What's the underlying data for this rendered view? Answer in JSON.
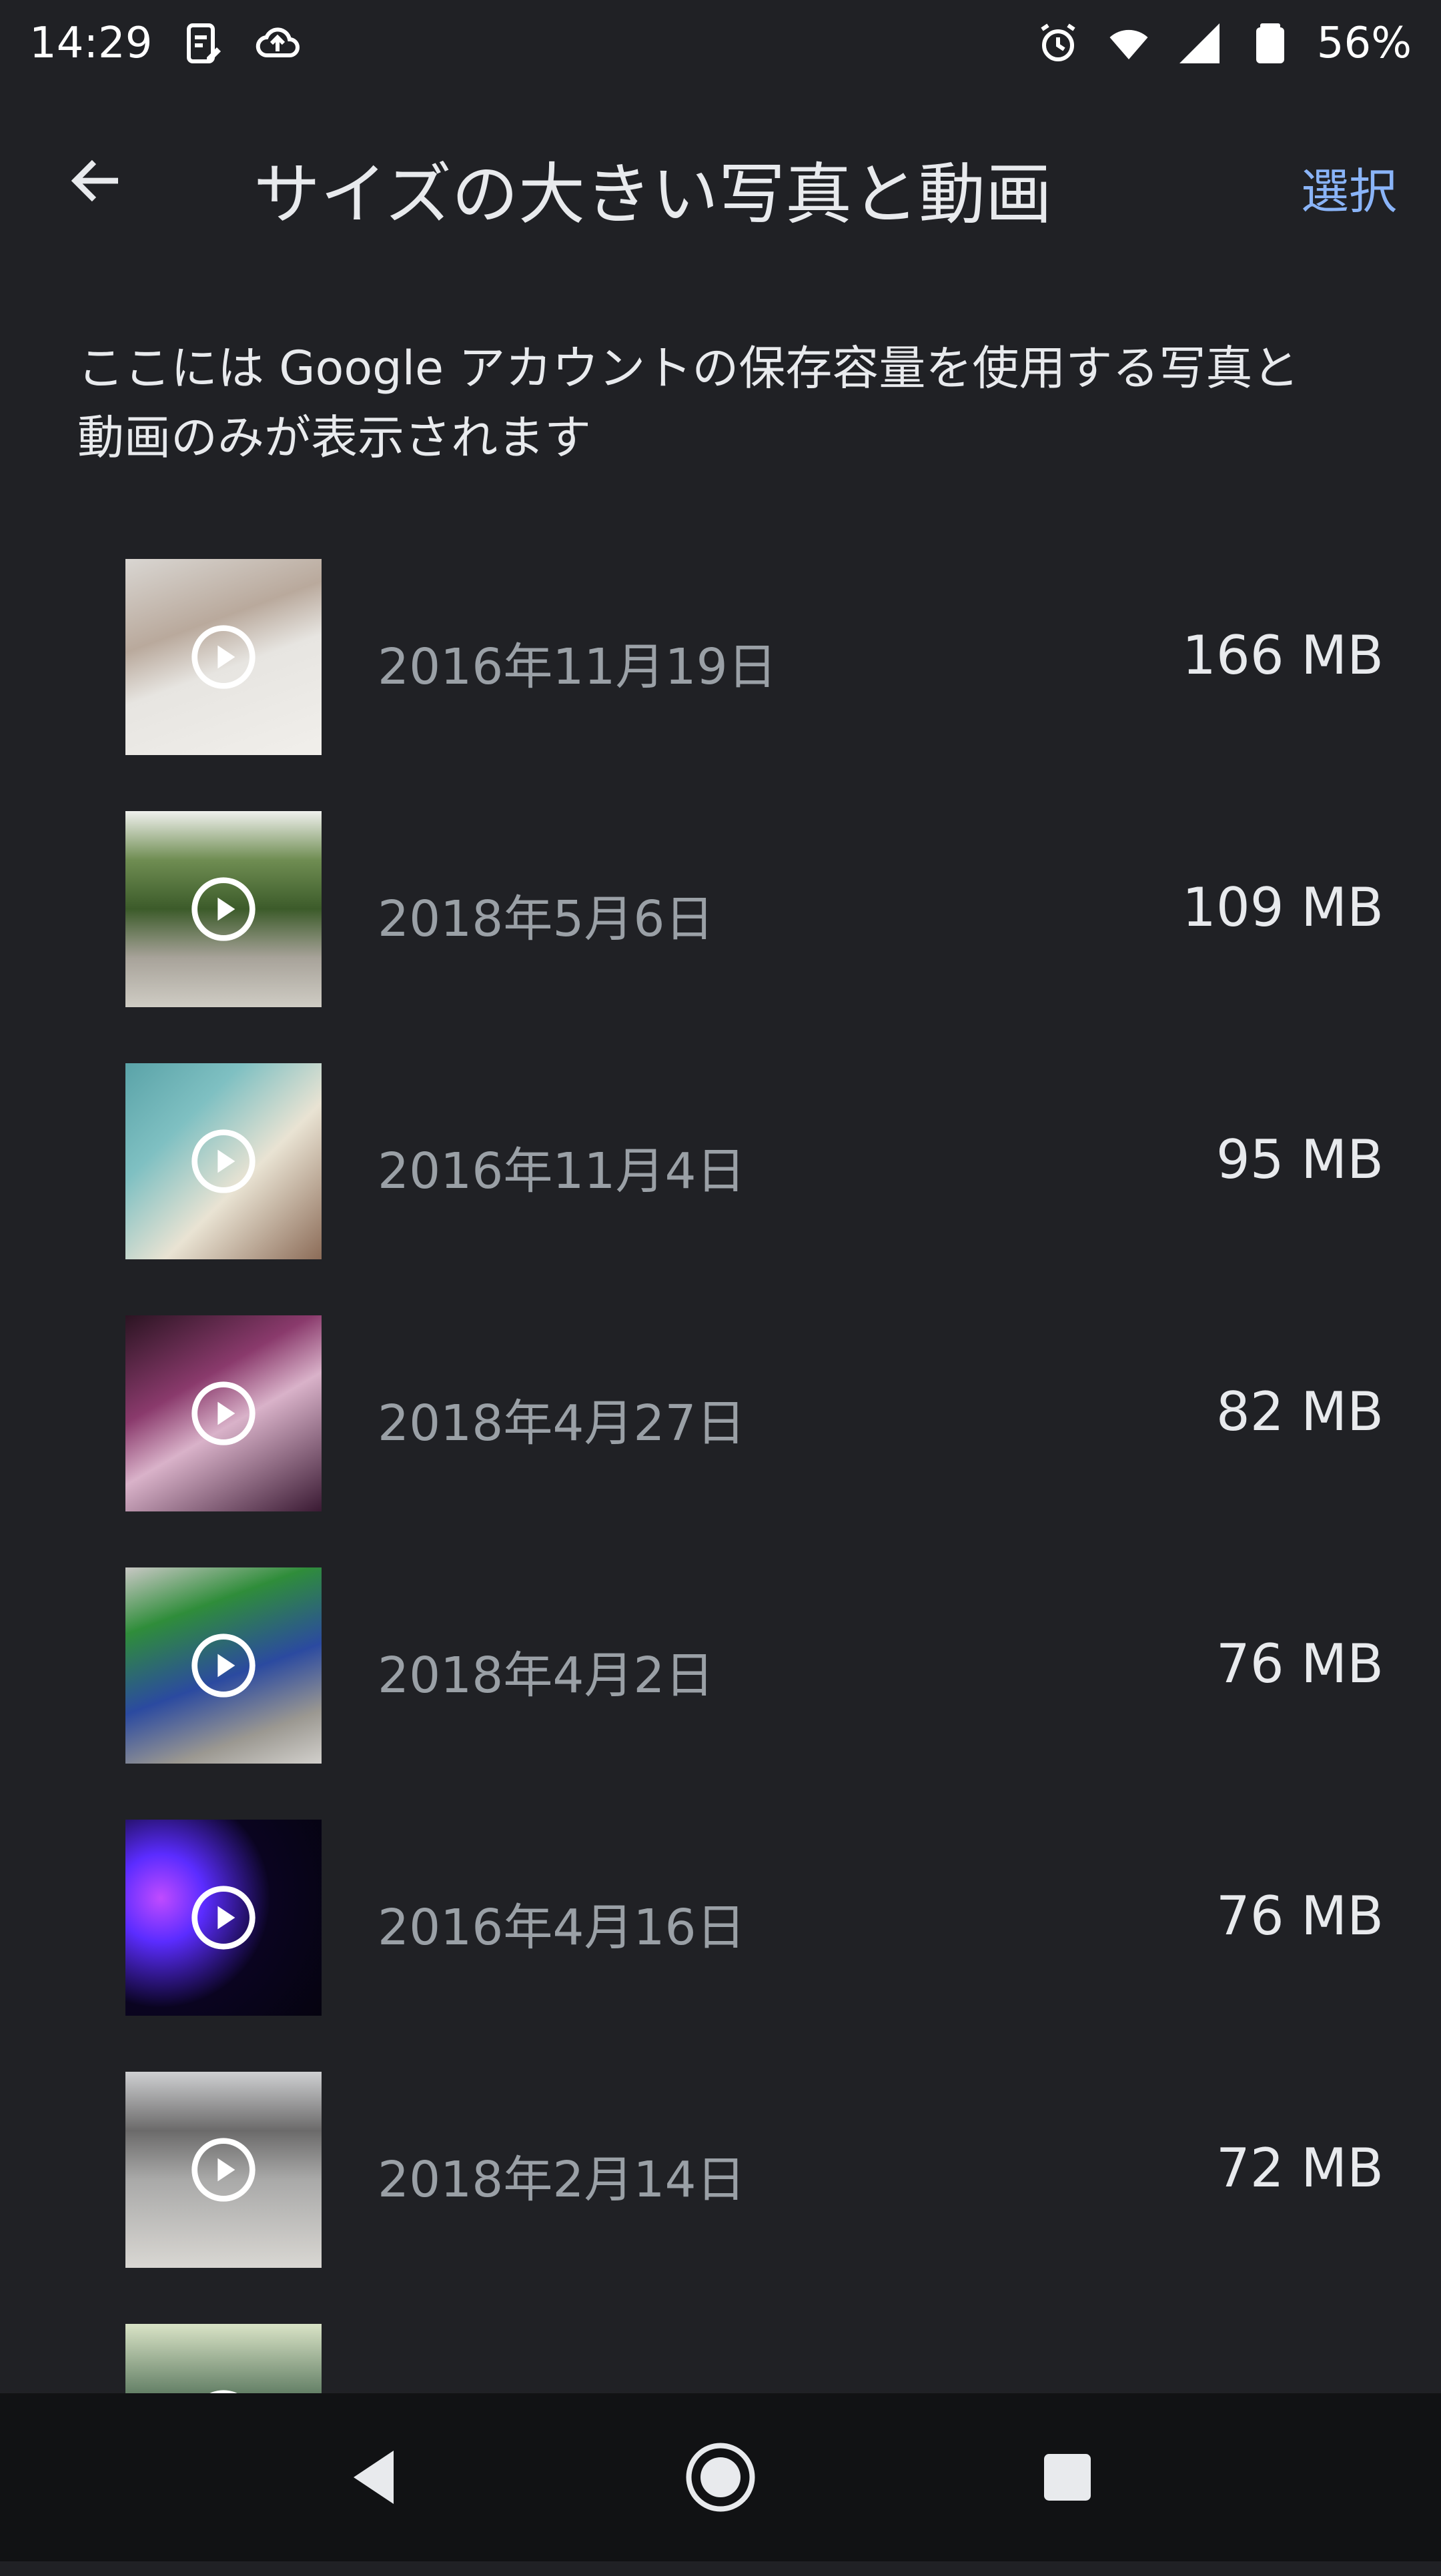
{
  "status_bar": {
    "time": "14:29",
    "battery": "56%",
    "icons_left": [
      "clipboard-edit-icon",
      "cloud-upload-icon"
    ],
    "icons_right": [
      "alarm-icon",
      "wifi-icon",
      "cellular-signal-icon",
      "battery-icon"
    ]
  },
  "app_bar": {
    "back_icon": "arrow-back-icon",
    "title": "サイズの大きい写真と動画",
    "select_label": "選択"
  },
  "description": {
    "line1": "ここには Google アカウントの保存容量を使用する写真と",
    "line2": "動画のみが表示されます"
  },
  "items": [
    {
      "date": "2016年11月19日",
      "size": "166 MB",
      "type": "video"
    },
    {
      "date": "2018年5月6日",
      "size": "109 MB",
      "type": "video"
    },
    {
      "date": "2016年11月4日",
      "size": "95 MB",
      "type": "video"
    },
    {
      "date": "2018年4月27日",
      "size": "82 MB",
      "type": "video"
    },
    {
      "date": "2018年4月2日",
      "size": "76 MB",
      "type": "video"
    },
    {
      "date": "2016年4月16日",
      "size": "76 MB",
      "type": "video"
    },
    {
      "date": "2018年2月14日",
      "size": "72 MB",
      "type": "video"
    },
    {
      "date": "",
      "size": "",
      "type": "video"
    }
  ],
  "colors": {
    "background": "#202125",
    "accent": "#8ab4f8",
    "text_primary": "#e8eaed",
    "text_secondary": "#9aa0a6",
    "nav_bar": "#111214"
  },
  "nav_bar": {
    "back_icon": "nav-back-triangle-icon",
    "home_icon": "nav-home-circle-icon",
    "recents_icon": "nav-recents-square-icon"
  }
}
